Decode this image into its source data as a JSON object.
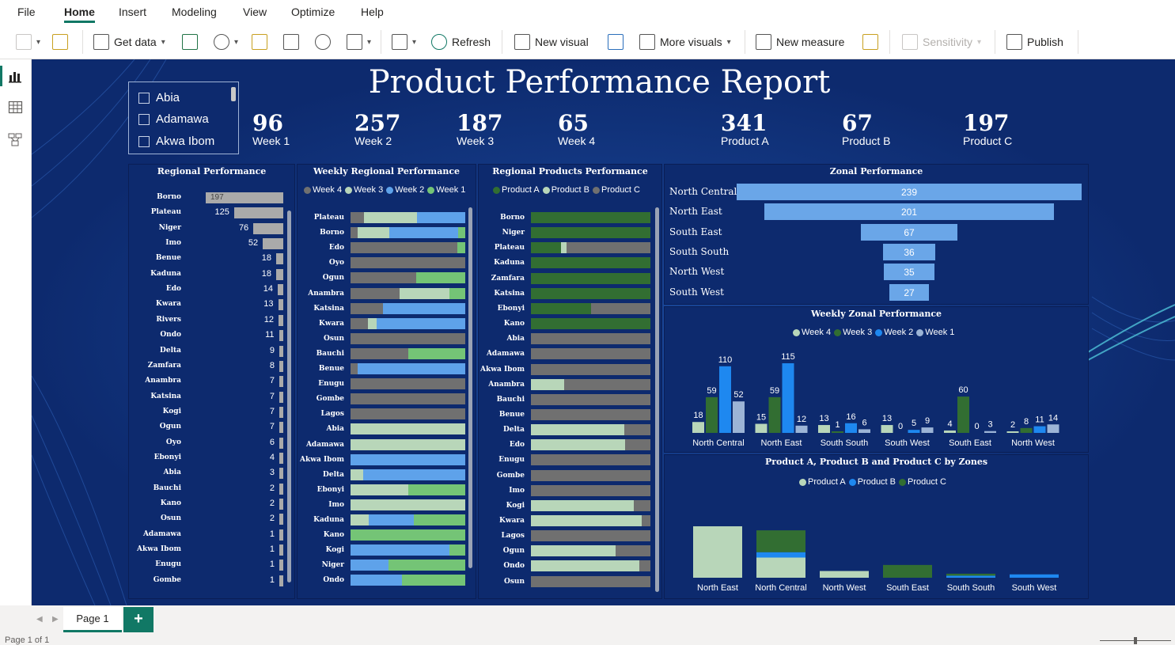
{
  "menu": [
    "File",
    "Home",
    "Insert",
    "Modeling",
    "View",
    "Optimize",
    "Help"
  ],
  "ribbon": {
    "get_data": "Get data",
    "refresh": "Refresh",
    "new_visual": "New visual",
    "more_visuals": "More visuals",
    "new_measure": "New measure",
    "sensitivity": "Sensitivity",
    "publish": "Publish"
  },
  "report": {
    "title": "Product Performance Report",
    "slicer": [
      "Abia",
      "Adamawa",
      "Akwa Ibom"
    ],
    "kpis": [
      {
        "value": "96",
        "label": "Week 1"
      },
      {
        "value": "257",
        "label": "Week 2"
      },
      {
        "value": "187",
        "label": "Week 3"
      },
      {
        "value": "65",
        "label": "Week 4"
      },
      {
        "value": "341",
        "label": "Product A"
      },
      {
        "value": "67",
        "label": "Product B"
      },
      {
        "value": "197",
        "label": "Product C"
      }
    ],
    "titles": {
      "regional": "Regional Performance",
      "weekly_regional": "Weekly Regional Performance",
      "regional_products": "Regional Products Performance",
      "zonal": "Zonal Performance",
      "weekly_zonal": "Weekly Zonal Performance",
      "products_by_zone": "Product A, Product B and Product C by Zones"
    }
  },
  "colors": {
    "week1": "#9cb4d6",
    "week2": "#1e88f0",
    "week3": "#b8d6b9",
    "week4": "#326e32",
    "productA": "#b8d6b9",
    "productB": "#1e88f0",
    "productC": "#326e32",
    "gray": "#707070",
    "lightgreen": "#74c476",
    "lightblue": "#5ea2ea",
    "funnel": "#6aa6e8"
  },
  "footer": {
    "page_tab": "Page 1",
    "add": "+",
    "page_count": "Page 1 of 1"
  },
  "chart_data": [
    {
      "type": "bar",
      "title": "Regional Performance",
      "categories": [
        "Borno",
        "Plateau",
        "Niger",
        "Imo",
        "Benue",
        "Kaduna",
        "Edo",
        "Kwara",
        "Rivers",
        "Ondo",
        "Delta",
        "Zamfara",
        "Anambra",
        "Katsina",
        "Kogi",
        "Ogun",
        "Oyo",
        "Ebonyi",
        "Abia",
        "Bauchi",
        "Kano",
        "Osun",
        "Adamawa",
        "Akwa Ibom",
        "Enugu",
        "Gombe"
      ],
      "values": [
        197,
        125,
        76,
        52,
        18,
        18,
        14,
        13,
        12,
        11,
        9,
        8,
        7,
        7,
        7,
        7,
        6,
        4,
        3,
        2,
        2,
        2,
        1,
        1,
        1,
        1
      ]
    },
    {
      "type": "bar",
      "title": "Weekly Regional Performance",
      "legend": [
        "Week 4",
        "Week 3",
        "Week 2",
        "Week 1"
      ],
      "categories": [
        "Plateau",
        "Borno",
        "Edo",
        "Oyo",
        "Ogun",
        "Anambra",
        "Katsina",
        "Kwara",
        "Osun",
        "Bauchi",
        "Benue",
        "Enugu",
        "Gombe",
        "Lagos",
        "Abia",
        "Adamawa",
        "Akwa Ibom",
        "Delta",
        "Ebonyi",
        "Imo",
        "Kaduna",
        "Kano",
        "Kogi",
        "Niger",
        "Ondo"
      ]
    },
    {
      "type": "bar",
      "title": "Regional Products Performance",
      "legend": [
        "Product A",
        "Product B",
        "Product C"
      ],
      "categories": [
        "Borno",
        "Niger",
        "Plateau",
        "Kaduna",
        "Zamfara",
        "Katsina",
        "Ebonyi",
        "Kano",
        "Abia",
        "Adamawa",
        "Akwa Ibom",
        "Anambra",
        "Bauchi",
        "Benue",
        "Delta",
        "Edo",
        "Enugu",
        "Gombe",
        "Imo",
        "Kogi",
        "Kwara",
        "Lagos",
        "Ogun",
        "Ondo",
        "Osun"
      ]
    },
    {
      "type": "bar",
      "title": "Zonal Performance",
      "categories": [
        "North Central",
        "North East",
        "South East",
        "South South",
        "North West",
        "South West"
      ],
      "values": [
        239,
        201,
        67,
        36,
        35,
        27
      ]
    },
    {
      "type": "bar",
      "title": "Weekly Zonal Performance",
      "categories": [
        "North Central",
        "North East",
        "South South",
        "South West",
        "South East",
        "North West"
      ],
      "series": [
        {
          "name": "Week 4",
          "values": [
            18,
            15,
            13,
            13,
            4,
            2
          ]
        },
        {
          "name": "Week 3",
          "values": [
            59,
            59,
            1,
            0,
            60,
            8
          ]
        },
        {
          "name": "Week 2",
          "values": [
            110,
            115,
            16,
            5,
            0,
            11
          ]
        },
        {
          "name": "Week 1",
          "values": [
            52,
            12,
            6,
            9,
            3,
            14
          ]
        }
      ]
    },
    {
      "type": "bar",
      "title": "Product A, Product B and Product C by Zones",
      "categories": [
        "North East",
        "North Central",
        "North West",
        "South East",
        "South South",
        "South West"
      ],
      "series": [
        {
          "name": "Product A",
          "values": [
            153,
            60,
            20,
            0,
            0,
            0
          ]
        },
        {
          "name": "Product B",
          "values": [
            0,
            16,
            0,
            0,
            6,
            10
          ]
        },
        {
          "name": "Product C",
          "values": [
            0,
            65,
            0,
            38,
            6,
            0
          ]
        }
      ]
    }
  ]
}
